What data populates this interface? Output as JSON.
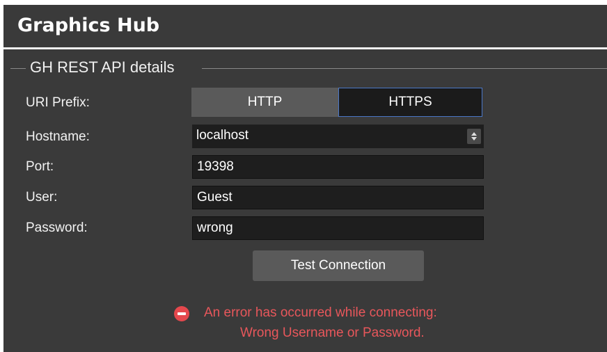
{
  "header": {
    "title": "Graphics Hub"
  },
  "section": {
    "legend": "GH REST API details"
  },
  "form": {
    "uri_prefix": {
      "label": "URI Prefix:",
      "options": [
        "HTTP",
        "HTTPS"
      ],
      "selected": "HTTPS"
    },
    "hostname": {
      "label": "Hostname:",
      "value": "localhost"
    },
    "port": {
      "label": "Port:",
      "value": "19398"
    },
    "user": {
      "label": "User:",
      "value": "Guest"
    },
    "password": {
      "label": "Password:",
      "value": "wrong"
    }
  },
  "actions": {
    "test_label": "Test Connection"
  },
  "error": {
    "icon": "error-minus-circle-icon",
    "line1": "An error has occurred while connecting:",
    "line2": "Wrong Username or Password.",
    "color": "#e8575b"
  },
  "colors": {
    "panel_bg": "#3a3a3a",
    "input_bg": "#1e1e1e",
    "selected_border": "#4b78c8"
  }
}
